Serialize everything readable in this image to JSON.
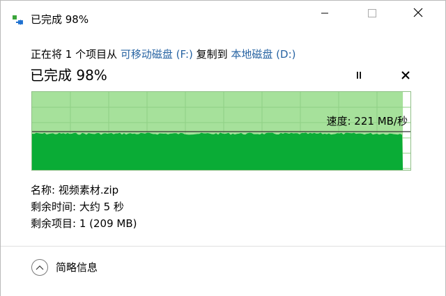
{
  "window": {
    "title": "已完成 98%",
    "controls": {
      "minimize": "minimize-icon",
      "maximize": "maximize-icon",
      "close": "close-icon"
    }
  },
  "transfer": {
    "prefix": "正在将 1 个项目从 ",
    "source": "可移动磁盘 (F:)",
    "middle": " 复制到 ",
    "destination": "本地磁盘 (D:)"
  },
  "progress": {
    "title": "已完成 98%",
    "percent": 98,
    "speed_label": "速度: 221 MB/秒"
  },
  "details": {
    "name_label": "名称:",
    "name_value": "视频素材.zip",
    "time_label": "剩余时间:",
    "time_value": "大约 5 秒",
    "items_label": "剩余项目:",
    "items_value": "1 (209 MB)"
  },
  "footer": {
    "more_label": "简略信息"
  },
  "colors": {
    "graph_fill": "#0aac36",
    "graph_progress": "#a6e19b",
    "link": "#2864a3"
  }
}
